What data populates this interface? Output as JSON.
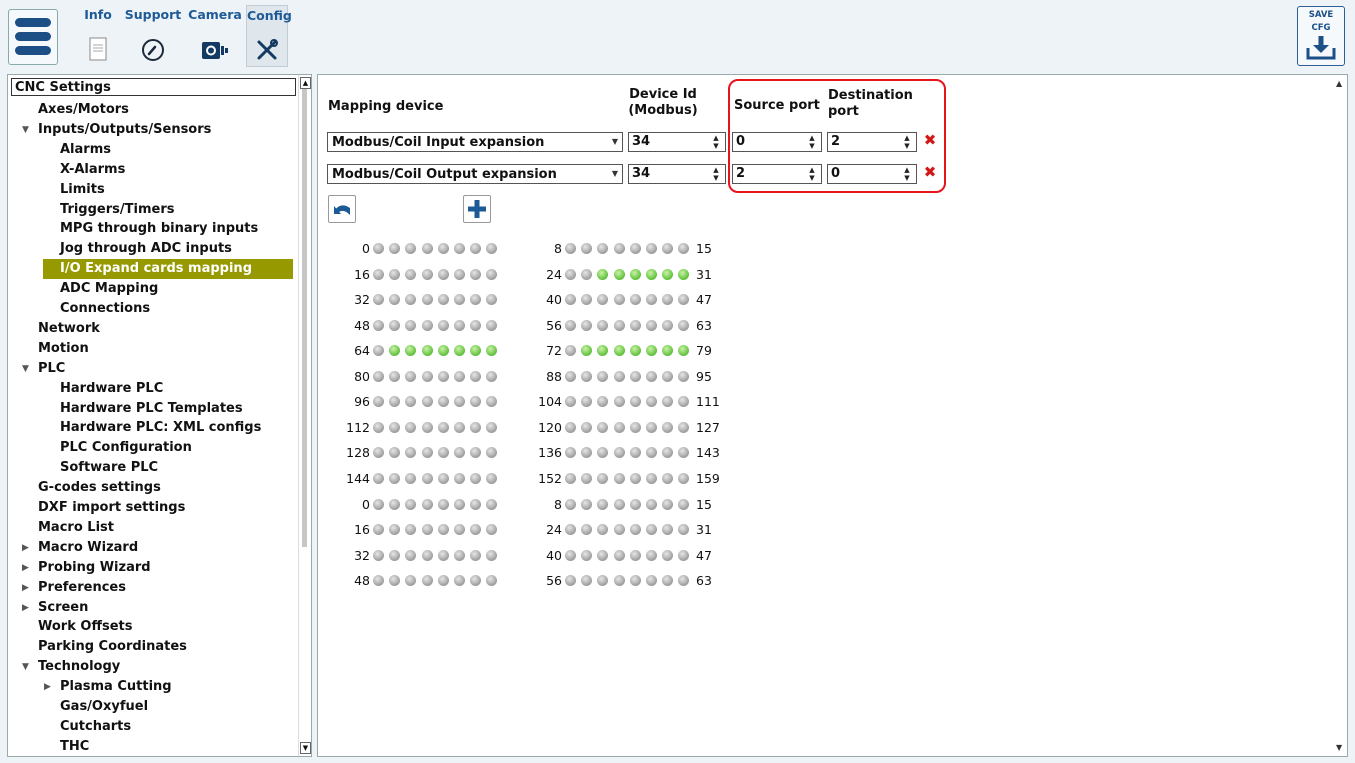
{
  "toolbar": {
    "tabs": [
      {
        "label": "Info",
        "icon": "document-icon"
      },
      {
        "label": "Support",
        "icon": "phone-icon"
      },
      {
        "label": "Camera",
        "icon": "camera-icon"
      },
      {
        "label": "Config",
        "icon": "tools-icon"
      }
    ],
    "active_tab": "Config",
    "save_line1": "SAVE",
    "save_line2": "CFG"
  },
  "sidebar": {
    "items": [
      {
        "label": "CNC Settings",
        "level": 0,
        "arrow": ""
      },
      {
        "label": "Axes/Motors",
        "level": 1,
        "arrow": ""
      },
      {
        "label": "Inputs/Outputs/Sensors",
        "level": 1,
        "arrow": "down"
      },
      {
        "label": "Alarms",
        "level": 2,
        "arrow": ""
      },
      {
        "label": "X-Alarms",
        "level": 2,
        "arrow": ""
      },
      {
        "label": "Limits",
        "level": 2,
        "arrow": ""
      },
      {
        "label": "Triggers/Timers",
        "level": 2,
        "arrow": ""
      },
      {
        "label": "MPG through binary inputs",
        "level": 2,
        "arrow": ""
      },
      {
        "label": "Jog through ADC inputs",
        "level": 2,
        "arrow": ""
      },
      {
        "label": "I/O Expand cards mapping",
        "level": 2,
        "arrow": "",
        "selected": true
      },
      {
        "label": "ADC Mapping",
        "level": 2,
        "arrow": ""
      },
      {
        "label": "Connections",
        "level": 2,
        "arrow": ""
      },
      {
        "label": "Network",
        "level": 1,
        "arrow": ""
      },
      {
        "label": "Motion",
        "level": 1,
        "arrow": ""
      },
      {
        "label": "PLC",
        "level": 1,
        "arrow": "down"
      },
      {
        "label": "Hardware PLC",
        "level": 2,
        "arrow": ""
      },
      {
        "label": "Hardware PLC Templates",
        "level": 2,
        "arrow": ""
      },
      {
        "label": "Hardware PLC: XML configs",
        "level": 2,
        "arrow": ""
      },
      {
        "label": "PLC Configuration",
        "level": 2,
        "arrow": ""
      },
      {
        "label": "Software PLC",
        "level": 2,
        "arrow": ""
      },
      {
        "label": "G-codes settings",
        "level": 1,
        "arrow": ""
      },
      {
        "label": "DXF import settings",
        "level": 1,
        "arrow": ""
      },
      {
        "label": "Macro List",
        "level": 1,
        "arrow": ""
      },
      {
        "label": "Macro Wizard",
        "level": 1,
        "arrow": "right"
      },
      {
        "label": "Probing Wizard",
        "level": 1,
        "arrow": "right"
      },
      {
        "label": "Preferences",
        "level": 1,
        "arrow": "right"
      },
      {
        "label": "Screen",
        "level": 1,
        "arrow": "right"
      },
      {
        "label": "Work Offsets",
        "level": 1,
        "arrow": ""
      },
      {
        "label": "Parking Coordinates",
        "level": 1,
        "arrow": ""
      },
      {
        "label": "Technology",
        "level": 1,
        "arrow": "down"
      },
      {
        "label": "Plasma Cutting",
        "level": 2,
        "arrow": "right"
      },
      {
        "label": "Gas/Oxyfuel",
        "level": 2,
        "arrow": ""
      },
      {
        "label": "Cutcharts",
        "level": 2,
        "arrow": ""
      },
      {
        "label": "THC",
        "level": 2,
        "arrow": ""
      }
    ]
  },
  "mapping": {
    "headers": {
      "device": "Mapping device",
      "device_id_1": "Device Id",
      "device_id_2": "(Modbus)",
      "source_port": "Source port",
      "dest_port_1": "Destination",
      "dest_port_2": "port"
    },
    "rows": [
      {
        "device": "Modbus/Coil Input expansion",
        "device_id": "34",
        "source_port": "0",
        "dest_port": "2"
      },
      {
        "device": "Modbus/Coil Output expansion",
        "device_id": "34",
        "source_port": "2",
        "dest_port": "0"
      }
    ],
    "accent_color": "#e8141c"
  },
  "led_grid": {
    "rows": [
      {
        "left_start": "0",
        "right_start": "8",
        "right_end": "15",
        "on": []
      },
      {
        "left_start": "16",
        "right_start": "24",
        "right_end": "31",
        "on": [
          26,
          27,
          28,
          29,
          30,
          31
        ]
      },
      {
        "left_start": "32",
        "right_start": "40",
        "right_end": "47",
        "on": []
      },
      {
        "left_start": "48",
        "right_start": "56",
        "right_end": "63",
        "on": []
      },
      {
        "left_start": "64",
        "right_start": "72",
        "right_end": "79",
        "on": [
          65,
          66,
          67,
          68,
          69,
          70,
          71,
          73,
          74,
          75,
          76,
          77,
          78,
          79
        ]
      },
      {
        "left_start": "80",
        "right_start": "88",
        "right_end": "95",
        "on": []
      },
      {
        "left_start": "96",
        "right_start": "104",
        "right_end": "111",
        "on": []
      },
      {
        "left_start": "112",
        "right_start": "120",
        "right_end": "127",
        "on": []
      },
      {
        "left_start": "128",
        "right_start": "136",
        "right_end": "143",
        "on": []
      },
      {
        "left_start": "144",
        "right_start": "152",
        "right_end": "159",
        "on": []
      },
      {
        "left_start": "0",
        "right_start": "8",
        "right_end": "15",
        "on": []
      },
      {
        "left_start": "16",
        "right_start": "24",
        "right_end": "31",
        "on": []
      },
      {
        "left_start": "32",
        "right_start": "40",
        "right_end": "47",
        "on": []
      },
      {
        "left_start": "48",
        "right_start": "56",
        "right_end": "63",
        "on": []
      }
    ]
  }
}
